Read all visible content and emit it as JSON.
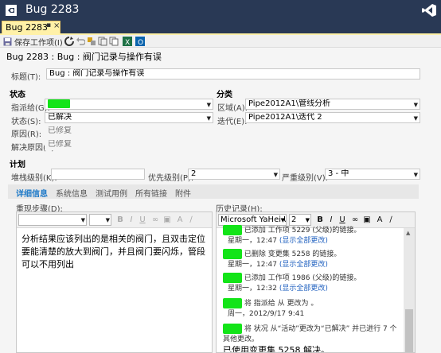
{
  "window": {
    "title": "Bug 2283"
  },
  "tab": {
    "label": "Bug 2283",
    "pin_icon": "▪",
    "close_icon": "×"
  },
  "toolbar": {
    "save_label": "保存工作项(I)"
  },
  "heading": "Bug 2283 : Bug : 阀门记录与操作有误",
  "form": {
    "title_label": "标题(T):",
    "title_value": "Bug : 阀门记录与操作有误",
    "status_section": "状态",
    "assigned_label": "指派给(G):",
    "state_label": "状态(S):",
    "state_value": "已解决",
    "reason_label": "原因(R):",
    "reason_value": "已修复",
    "resolved_reason_label": "解决原因(E):",
    "resolved_reason_value": "已修复",
    "classification_section": "分类",
    "area_label": "区域(A):",
    "area_value": "Pipe2012A1\\管线分析",
    "iteration_label": "迭代(E):",
    "iteration_value": "Pipe2012A1\\迭代 2",
    "planning_section": "计划",
    "stack_rank_label": "堆栈级别(K):",
    "stack_rank_value": "",
    "priority_label": "优先级别(P):",
    "priority_value": "2",
    "severity_label": "严重级别(V):",
    "severity_value": "3 - 中"
  },
  "subtabs": [
    "详细信息",
    "系统信息",
    "测试用例",
    "所有链接",
    "附件"
  ],
  "repro": {
    "label": "重现步骤(D):",
    "text": "分析结果应该列出的是相关的阀门，且双击定位要能清楚的放大到阀门，并且阀门要闪烁，管段可以不用列出"
  },
  "history": {
    "label": "历史记录(H):",
    "font_name": "Microsoft YaHei U",
    "font_size": "2",
    "entries": [
      {
        "text": "已添加 工作项 5229 (父级)的链接。",
        "date": "星期一，12:47",
        "link": "(显示全部更改)"
      },
      {
        "text": "已删除 变更集 5258 的链接。",
        "date": "星期一，12:47",
        "link": "(显示全部更改)"
      },
      {
        "text": "已添加 工作项 1986 (父级)的链接。",
        "date": "星期一，12:32",
        "link": "(显示全部更改)"
      },
      {
        "text": "将 指派给 从 更改为 。",
        "date": "周一，2012/9/17 9:41",
        "link": ""
      },
      {
        "text": "将 状况 从“活动”更改为“已解决” 并已进行 7 个其他更改。",
        "date": "",
        "link": ""
      }
    ],
    "last_line": "已使用变更集 5258 解决。"
  },
  "colors": {
    "accent": "#1e7ac8",
    "titlebar": "#293955",
    "tab": "#fff1a8",
    "redaction": "#13e418"
  }
}
